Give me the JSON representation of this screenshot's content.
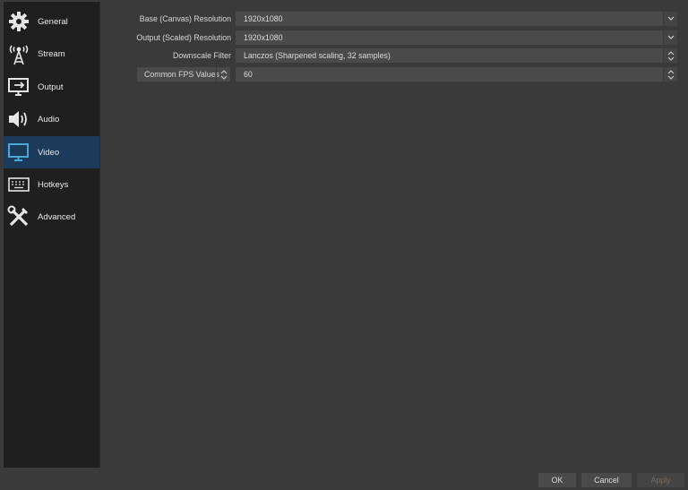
{
  "sidebar": {
    "items": [
      {
        "label": "General",
        "icon": "gear-icon",
        "active": false
      },
      {
        "label": "Stream",
        "icon": "broadcast-tower-icon",
        "active": false
      },
      {
        "label": "Output",
        "icon": "monitor-output-icon",
        "active": false
      },
      {
        "label": "Audio",
        "icon": "speaker-icon",
        "active": false
      },
      {
        "label": "Video",
        "icon": "monitor-icon",
        "active": true
      },
      {
        "label": "Hotkeys",
        "icon": "keyboard-icon",
        "active": false
      },
      {
        "label": "Advanced",
        "icon": "tools-icon",
        "active": false
      }
    ]
  },
  "video": {
    "base_resolution": {
      "label": "Base (Canvas) Resolution",
      "value": "1920x1080"
    },
    "output_resolution": {
      "label": "Output (Scaled) Resolution",
      "value": "1920x1080"
    },
    "downscale_filter": {
      "label": "Downscale Filter",
      "value": "Lanczos (Sharpened scaling, 32 samples)"
    },
    "fps": {
      "mode_label": "Common FPS Values",
      "value": "60"
    }
  },
  "buttons": {
    "ok": "OK",
    "cancel": "Cancel",
    "apply": "Apply"
  },
  "colors": {
    "active_item_bg": "#1c3a5a",
    "icon_color": "#e6e6e6",
    "active_icon_color": "#4aa8d8"
  }
}
